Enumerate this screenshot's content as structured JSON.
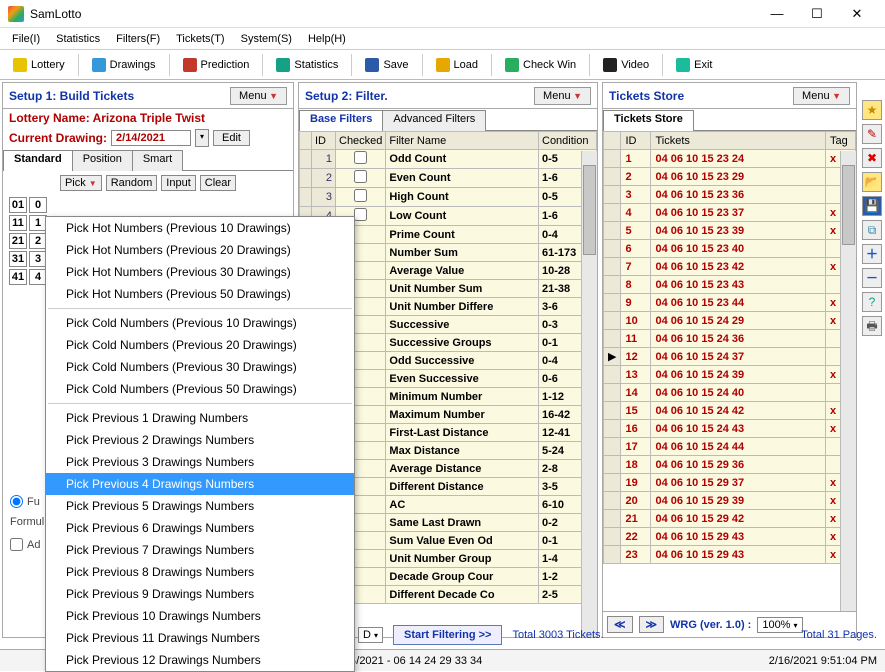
{
  "app": {
    "title": "SamLotto"
  },
  "menubar": [
    "File(I)",
    "Statistics",
    "Filters(F)",
    "Tickets(T)",
    "System(S)",
    "Help(H)"
  ],
  "toolbar": [
    {
      "label": "Lottery",
      "color": "#e8c400"
    },
    {
      "label": "Drawings",
      "color": "#3498db"
    },
    {
      "label": "Prediction",
      "color": "#c0392b"
    },
    {
      "label": "Statistics",
      "color": "#16a085"
    },
    {
      "label": "Save",
      "color": "#2b5aa8"
    },
    {
      "label": "Load",
      "color": "#e6a700"
    },
    {
      "label": "Check Win",
      "color": "#27ae60"
    },
    {
      "label": "Video",
      "color": "#222"
    },
    {
      "label": "Exit",
      "color": "#1abc9c"
    }
  ],
  "setup1": {
    "title": "Setup 1: Build  Tickets",
    "menu": "Menu",
    "lottery_label": "Lottery  Name: Arizona Triple Twist",
    "drawing_label": "Current Drawing:",
    "drawing_date": "2/14/2021",
    "edit": "Edit",
    "tabs": [
      "Standard",
      "Position",
      "Smart"
    ],
    "btns": {
      "pick": "Pick",
      "random": "Random",
      "input": "Input",
      "clear": "Clear"
    },
    "numgrid": [
      [
        "01",
        "0"
      ],
      [
        "11",
        "1"
      ],
      [
        "21",
        "2"
      ],
      [
        "31",
        "3"
      ],
      [
        "41",
        "4"
      ]
    ],
    "dropdown": {
      "group1": [
        "Pick Hot Numbers (Previous 10 Drawings)",
        "Pick Hot Numbers (Previous 20 Drawings)",
        "Pick Hot Numbers (Previous 30 Drawings)",
        "Pick Hot Numbers (Previous 50 Drawings)"
      ],
      "group2": [
        "Pick Cold Numbers (Previous 10 Drawings)",
        "Pick Cold Numbers (Previous 20 Drawings)",
        "Pick Cold Numbers (Previous 30 Drawings)",
        "Pick Cold Numbers (Previous 50 Drawings)"
      ],
      "group3": [
        "Pick Previous 1 Drawing Numbers",
        "Pick Previous 2 Drawings Numbers",
        "Pick Previous 3 Drawings Numbers",
        "Pick Previous 4 Drawings Numbers",
        "Pick Previous 5 Drawings Numbers",
        "Pick Previous 6 Drawings Numbers",
        "Pick Previous 7 Drawings Numbers",
        "Pick Previous 8 Drawings Numbers",
        "Pick Previous 9 Drawings Numbers",
        "Pick Previous 10 Drawings Numbers",
        "Pick Previous 11 Drawings Numbers",
        "Pick Previous 12 Drawings Numbers"
      ],
      "selected": "Pick Previous 4 Drawings Numbers"
    },
    "partial": {
      "fu": "Fu",
      "formul": "Formul",
      "ad": "Ad"
    }
  },
  "setup2": {
    "title": "Setup 2: Filter.",
    "menu": "Menu",
    "tabs": [
      "Base Filters",
      "Advanced Filters"
    ],
    "headers": [
      "ID",
      "Checked",
      "Filter Name",
      "Condition"
    ],
    "rows": [
      {
        "id": "1",
        "name": "Odd Count",
        "cond": "0-5"
      },
      {
        "id": "2",
        "name": "Even Count",
        "cond": "1-6"
      },
      {
        "id": "3",
        "name": "High Count",
        "cond": "0-5"
      },
      {
        "id": "4",
        "name": "Low Count",
        "cond": "1-6"
      },
      {
        "id": "",
        "name": "Prime Count",
        "cond": "0-4"
      },
      {
        "id": "",
        "name": "Number Sum",
        "cond": "61-173"
      },
      {
        "id": "",
        "name": "Average Value",
        "cond": "10-28"
      },
      {
        "id": "",
        "name": "Unit Number Sum",
        "cond": "21-38"
      },
      {
        "id": "",
        "name": "Unit Number Differe",
        "cond": "3-6"
      },
      {
        "id": "",
        "name": "Successive",
        "cond": "0-3"
      },
      {
        "id": "",
        "name": "Successive Groups",
        "cond": "0-1"
      },
      {
        "id": "",
        "name": "Odd Successive",
        "cond": "0-4"
      },
      {
        "id": "",
        "name": "Even Successive",
        "cond": "0-6"
      },
      {
        "id": "",
        "name": "Minimum Number",
        "cond": "1-12"
      },
      {
        "id": "",
        "name": "Maximum Number",
        "cond": "16-42"
      },
      {
        "id": "",
        "name": "First-Last Distance",
        "cond": "12-41"
      },
      {
        "id": "",
        "name": "Max Distance",
        "cond": "5-24"
      },
      {
        "id": "",
        "name": "Average Distance",
        "cond": "2-8"
      },
      {
        "id": "",
        "name": "Different Distance",
        "cond": "3-5"
      },
      {
        "id": "",
        "name": "AC",
        "cond": "6-10"
      },
      {
        "id": "",
        "name": "Same Last Drawn",
        "cond": "0-2"
      },
      {
        "id": "",
        "name": "Sum Value Even Od",
        "cond": "0-1"
      },
      {
        "id": "",
        "name": "Unit Number Group",
        "cond": "1-4"
      },
      {
        "id": "",
        "name": "Decade Group Cour",
        "cond": "1-2"
      },
      {
        "id": "",
        "name": "Different Decade Co",
        "cond": "2-5"
      }
    ]
  },
  "tickets": {
    "title": "Tickets Store",
    "menu": "Menu",
    "tab": "Tickets Store",
    "headers": [
      "ID",
      "Tickets",
      "Tag"
    ],
    "selected_row": 12,
    "rows": [
      {
        "id": "1",
        "t": "04 06 10 15 23 24",
        "tag": "x"
      },
      {
        "id": "2",
        "t": "04 06 10 15 23 29",
        "tag": ""
      },
      {
        "id": "3",
        "t": "04 06 10 15 23 36",
        "tag": ""
      },
      {
        "id": "4",
        "t": "04 06 10 15 23 37",
        "tag": "x"
      },
      {
        "id": "5",
        "t": "04 06 10 15 23 39",
        "tag": "x"
      },
      {
        "id": "6",
        "t": "04 06 10 15 23 40",
        "tag": ""
      },
      {
        "id": "7",
        "t": "04 06 10 15 23 42",
        "tag": "x"
      },
      {
        "id": "8",
        "t": "04 06 10 15 23 43",
        "tag": ""
      },
      {
        "id": "9",
        "t": "04 06 10 15 23 44",
        "tag": "x"
      },
      {
        "id": "10",
        "t": "04 06 10 15 24 29",
        "tag": "x"
      },
      {
        "id": "11",
        "t": "04 06 10 15 24 36",
        "tag": ""
      },
      {
        "id": "12",
        "t": "04 06 10 15 24 37",
        "tag": ""
      },
      {
        "id": "13",
        "t": "04 06 10 15 24 39",
        "tag": "x"
      },
      {
        "id": "14",
        "t": "04 06 10 15 24 40",
        "tag": ""
      },
      {
        "id": "15",
        "t": "04 06 10 15 24 42",
        "tag": "x"
      },
      {
        "id": "16",
        "t": "04 06 10 15 24 43",
        "tag": "x"
      },
      {
        "id": "17",
        "t": "04 06 10 15 24 44",
        "tag": ""
      },
      {
        "id": "18",
        "t": "04 06 10 15 29 36",
        "tag": ""
      },
      {
        "id": "19",
        "t": "04 06 10 15 29 37",
        "tag": "x"
      },
      {
        "id": "20",
        "t": "04 06 10 15 29 39",
        "tag": "x"
      },
      {
        "id": "21",
        "t": "04 06 10 15 29 42",
        "tag": "x"
      },
      {
        "id": "22",
        "t": "04 06 10 15 29 43",
        "tag": "x"
      },
      {
        "id": "23",
        "t": "04 06 10 15 29 43",
        "tag": "x"
      }
    ],
    "footer": {
      "wrg": "WRG  (ver. 1.0) :",
      "zoom": "100%"
    }
  },
  "bottom": {
    "combo": "D",
    "start": "Start Filtering >>",
    "total_tickets": "Total 3003 Tickets.",
    "total_pages": "Total 31 Pages."
  },
  "status": {
    "center": "Sunday 2/14/2021 - 06 14 24 29 33 34",
    "right": "2/16/2021 9:51:04 PM"
  }
}
